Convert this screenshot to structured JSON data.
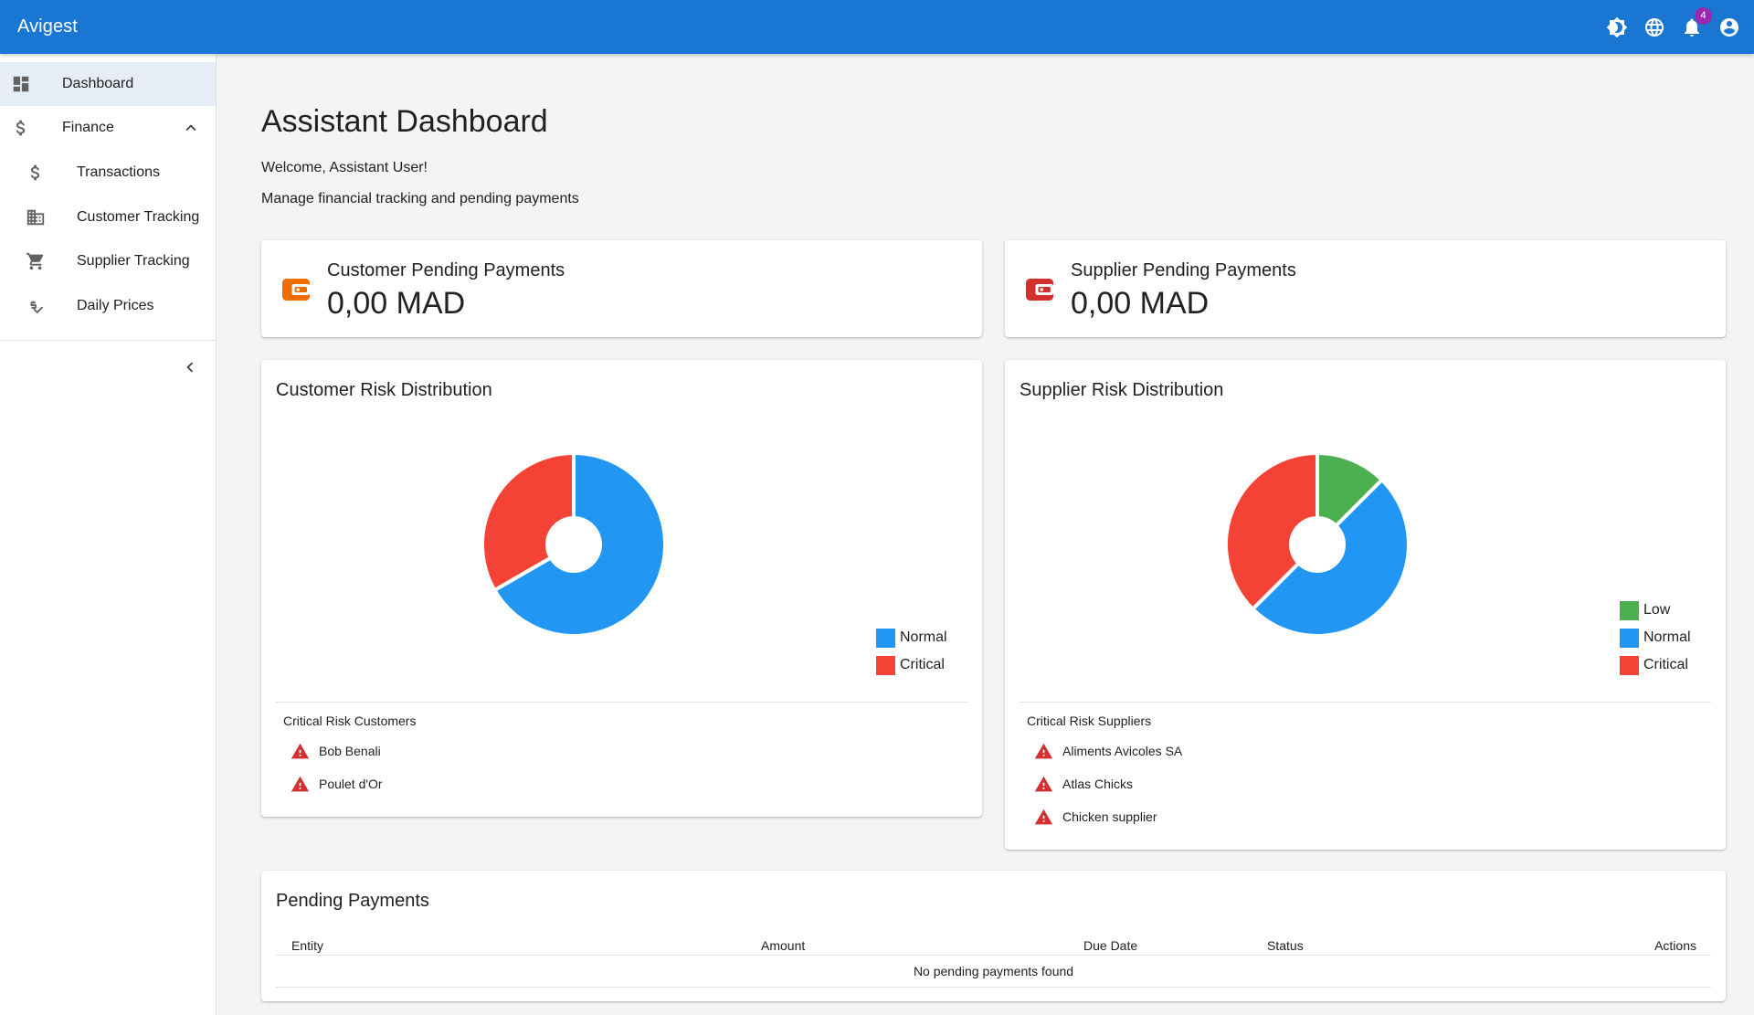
{
  "app": {
    "title": "Avigest",
    "notification_count": "4"
  },
  "topbar": {
    "icons": [
      "brightness-icon",
      "language-icon",
      "notifications-icon",
      "account-icon"
    ]
  },
  "sidebar": {
    "items": [
      {
        "label": "Dashboard",
        "icon": "dashboard-icon",
        "active": true
      },
      {
        "label": "Finance",
        "icon": "dollar-icon",
        "expanded": true
      },
      {
        "label": "Transactions",
        "icon": "dollar-icon"
      },
      {
        "label": "Customer Tracking",
        "icon": "business-icon"
      },
      {
        "label": "Supplier Tracking",
        "icon": "cart-icon"
      },
      {
        "label": "Daily Prices",
        "icon": "price-check-icon"
      }
    ],
    "collapse_icon": "chevron-left-icon"
  },
  "main": {
    "title": "Assistant Dashboard",
    "welcome": "Welcome, Assistant User!",
    "subtitle": "Manage financial tracking and pending payments"
  },
  "stats": {
    "customer": {
      "label": "Customer Pending Payments",
      "value": "0,00 MAD",
      "icon": "wallet-icon",
      "color": "#ef6c00"
    },
    "supplier": {
      "label": "Supplier Pending Payments",
      "value": "0,00 MAD",
      "icon": "wallet-icon",
      "color": "#d32f2f"
    }
  },
  "customer_risk": {
    "title": "Customer Risk Distribution",
    "legend": [
      {
        "label": "Normal",
        "color": "#2196f3"
      },
      {
        "label": "Critical",
        "color": "#f44336"
      }
    ],
    "critical_title": "Critical Risk Customers",
    "critical_list": [
      "Bob Benali",
      "Poulet d'Or"
    ]
  },
  "supplier_risk": {
    "title": "Supplier Risk Distribution",
    "legend": [
      {
        "label": "Low",
        "color": "#4caf50"
      },
      {
        "label": "Normal",
        "color": "#2196f3"
      },
      {
        "label": "Critical",
        "color": "#f44336"
      }
    ],
    "critical_title": "Critical Risk Suppliers",
    "critical_list": [
      "Aliments Avicoles SA",
      "Atlas Chicks",
      "Chicken supplier"
    ]
  },
  "chart_data": [
    {
      "type": "pie",
      "title": "Customer Risk Distribution",
      "categories": [
        "Normal",
        "Critical"
      ],
      "values": [
        2,
        1
      ],
      "colors": [
        "#2196f3",
        "#f44336"
      ],
      "legend": "bottom-right",
      "donut": true
    },
    {
      "type": "pie",
      "title": "Supplier Risk Distribution",
      "categories": [
        "Low",
        "Normal",
        "Critical"
      ],
      "values": [
        1,
        4,
        3
      ],
      "colors": [
        "#4caf50",
        "#2196f3",
        "#f44336"
      ],
      "legend": "bottom-right",
      "donut": true
    }
  ],
  "pending": {
    "title": "Pending Payments",
    "columns": [
      "Entity",
      "Amount",
      "Due Date",
      "Status",
      "Actions"
    ],
    "empty_message": "No pending payments found"
  }
}
